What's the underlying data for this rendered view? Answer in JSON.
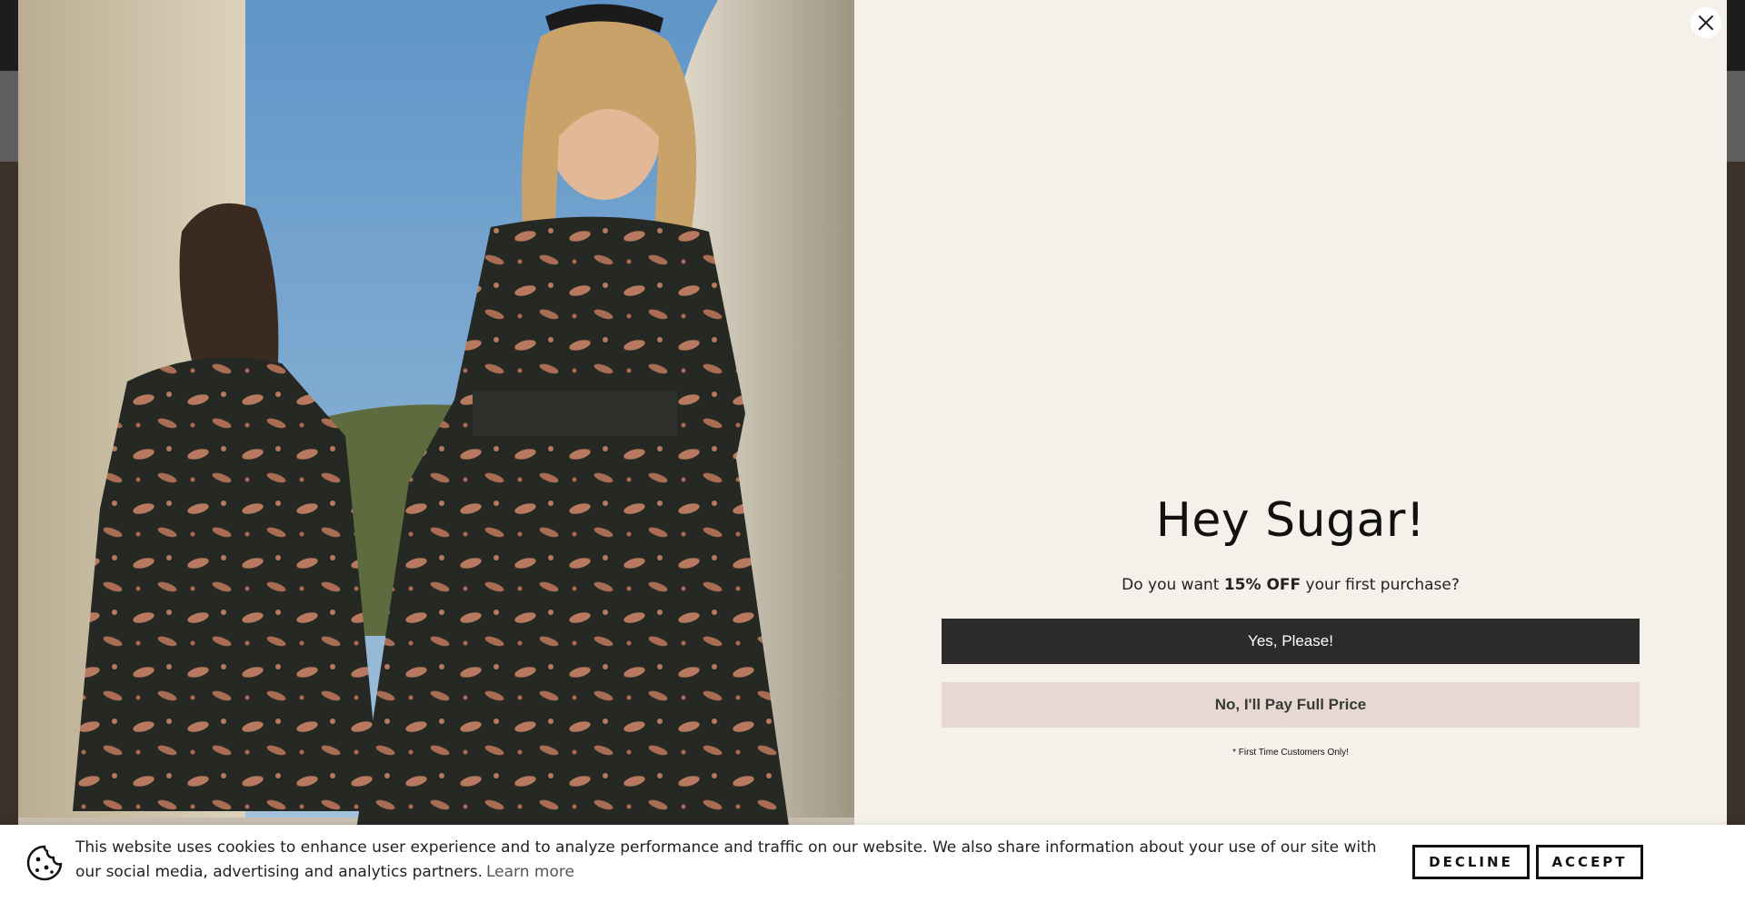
{
  "popup": {
    "headline": "Hey Sugar!",
    "subtext_prefix": "Do you want ",
    "subtext_bold": "15% OFF",
    "subtext_suffix": " your first purchase?",
    "yes_label": "Yes, Please!",
    "no_label": "No, I'll Pay Full Price",
    "disclaimer": "* First Time Customers Only!",
    "close_icon": "close-icon"
  },
  "cookie_banner": {
    "text": "This website uses cookies to enhance user experience and to analyze performance and traffic on our website. We also share information about your use of our site with our social media, advertising and analytics partners.",
    "learn_more": "Learn more",
    "decline_label": "DECLINE",
    "accept_label": "ACCEPT",
    "icon": "cookie-icon"
  },
  "colors": {
    "modal_bg": "#f5f1ea",
    "primary_button": "#2b2b2b",
    "secondary_button": "#e7d9d1",
    "banner_bg": "#ffffff"
  }
}
